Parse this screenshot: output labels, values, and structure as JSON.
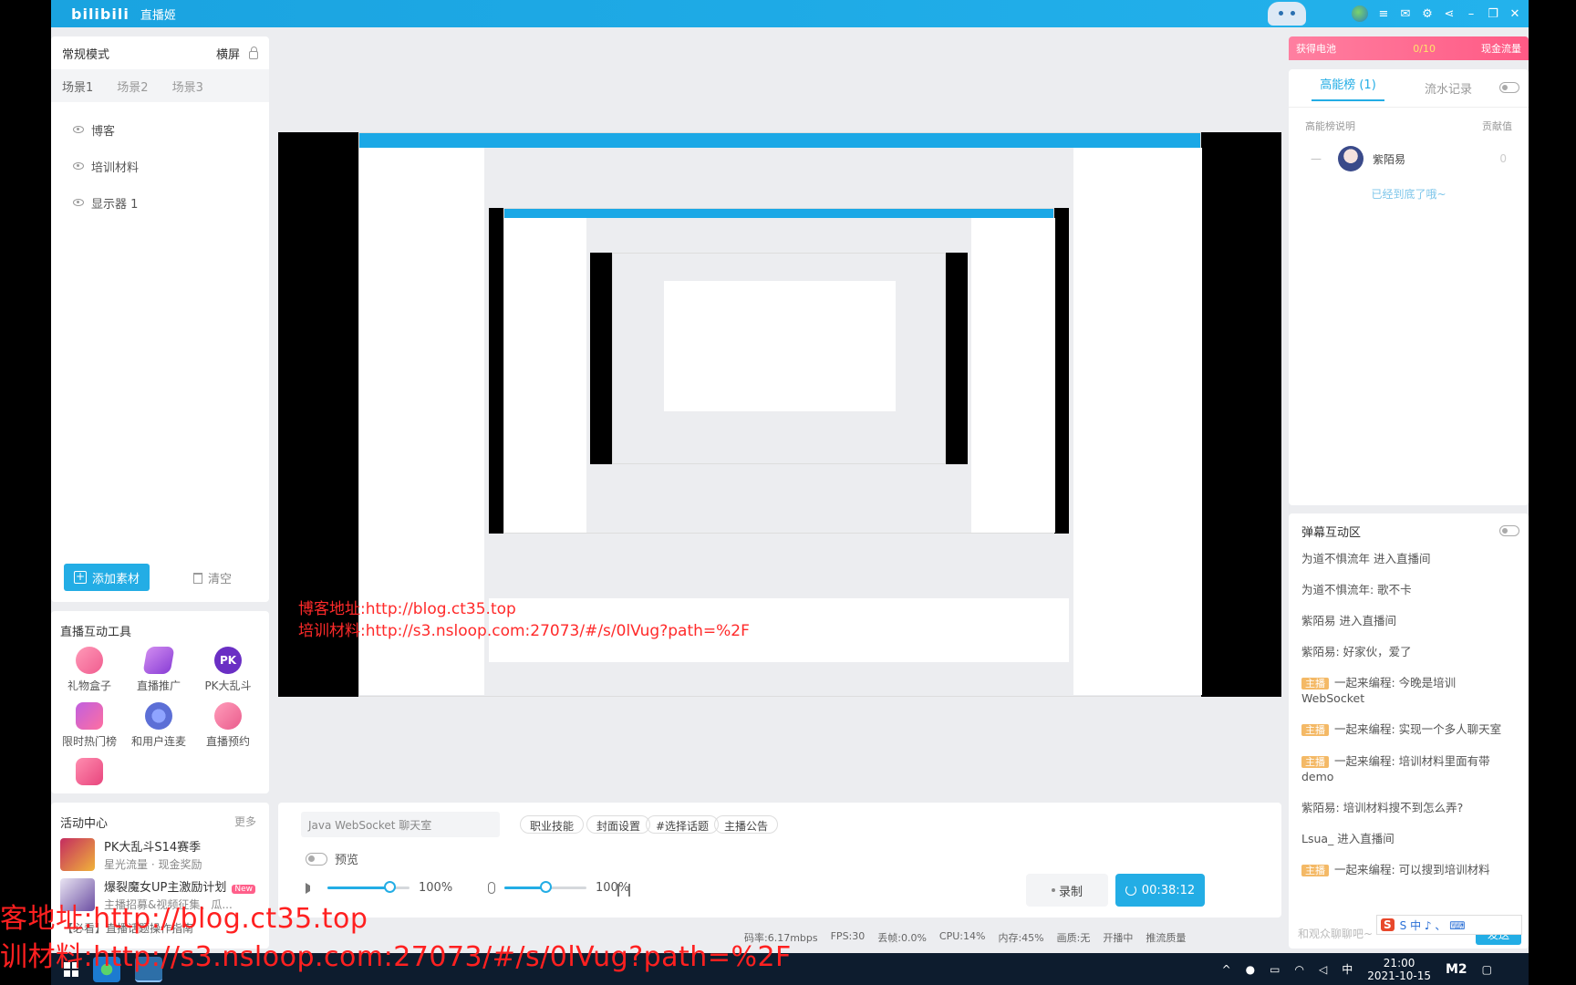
{
  "app": {
    "logo": "bilibili",
    "title": "直播姬"
  },
  "left": {
    "mode": "常规模式",
    "orientation": "横屏",
    "scenes": [
      "场景1",
      "场景2",
      "场景3"
    ],
    "sources": [
      "博客",
      "培训材料",
      "显示器 1"
    ],
    "add_label": "添加素材",
    "clear_label": "清空"
  },
  "tools": {
    "title": "直播互动工具",
    "items": [
      "礼物盒子",
      "直播推广",
      "PK大乱斗",
      "限时热门榜",
      "和用户连麦",
      "直播预约"
    ],
    "pk_glyph": "PK"
  },
  "activity": {
    "title": "活动中心",
    "more": "更多",
    "items": [
      {
        "title": "PK大乱斗S14赛季",
        "sub": "星光流量 · 现金奖励"
      },
      {
        "title": "爆裂魔女UP主激励计划",
        "sub": "主播招募&视频征集、瓜...",
        "badge": "New"
      }
    ],
    "footer": "【必看】直播话题操作指南"
  },
  "control": {
    "topic": "Java WebSocket 聊天室",
    "tags": [
      "职业技能",
      "封面设置",
      "#选择话题",
      "主播公告"
    ],
    "preview_label": "预览",
    "speaker_volume": "100%",
    "mic_volume": "100%",
    "speaker_level": 0.75,
    "mic_level": 0.5,
    "record_label": "录制",
    "live_time": "00:38:12"
  },
  "status": [
    "码率:6.17mbps",
    "FPS:30",
    "丢帧:0.0%",
    "CPU:14%",
    "内存:45%",
    "画质:无",
    "开播中",
    "推流质量"
  ],
  "right": {
    "battery_label": "获得电池",
    "battery_count": "0/10",
    "cash_label": "现金流量",
    "tabs": [
      "高能榜 (1)",
      "流水记录"
    ],
    "rank_explain": "高能榜说明",
    "rank_col": "贡献值",
    "rank": [
      {
        "pos": "—",
        "name": "紫陌易",
        "score": "0"
      }
    ],
    "rank_end": "已经到底了哦~",
    "dm_title": "弹幕互动区",
    "dm": [
      {
        "user": "",
        "text": "为道不惧流年 进入直播间"
      },
      {
        "user": "",
        "text": "为道不惧流年: 歌不卡"
      },
      {
        "user": "",
        "text": "紫陌易 进入直播间"
      },
      {
        "user": "",
        "text": "紫陌易: 好家伙，爱了"
      },
      {
        "host": "主播",
        "text": "一起来编程: 今晚是培训WebSocket"
      },
      {
        "host": "主播",
        "text": "一起来编程: 实现一个多人聊天室"
      },
      {
        "host": "主播",
        "text": "一起来编程: 培训材料里面有带demo"
      },
      {
        "user": "",
        "text": "紫陌易: 培训材料搜不到怎么弄?"
      },
      {
        "user": "",
        "text": "Lsua_ 进入直播间"
      },
      {
        "host": "主播",
        "text": "一起来编程: 可以搜到培训材料"
      }
    ],
    "dm_placeholder": "和观众聊聊吧~",
    "send_label": "发送",
    "ime_chars": "S 中 ♪ 、 ⌨"
  },
  "watermark": {
    "blog": "博客地址:http://blog.ct35.top",
    "material": "培训材料:http://s3.nsloop.com:27073/#/s/0lVug?path=%2F",
    "big_blog": "客地址:http://blog.ct35.top",
    "big_material": "训材料:http://s3.nsloop.com:27073/#/s/0lVug?path=%2F"
  },
  "taskbar": {
    "time": "21:00",
    "date": "2021-10-15",
    "ime": "中",
    "mark": "M2"
  }
}
